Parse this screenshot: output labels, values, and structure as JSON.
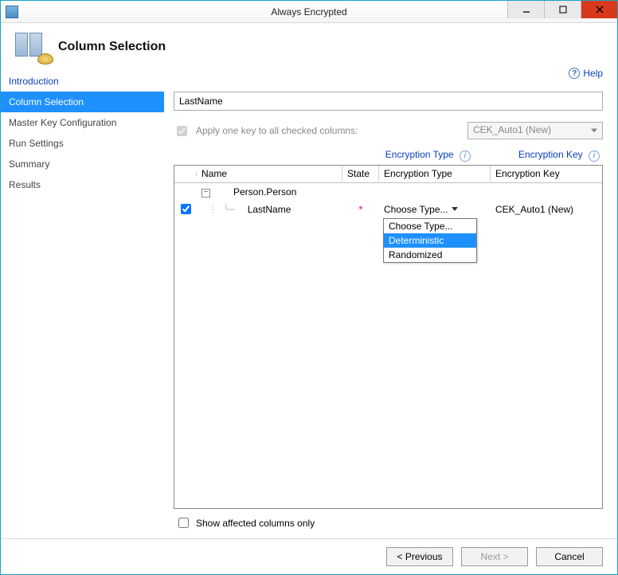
{
  "window": {
    "title": "Always Encrypted"
  },
  "header": {
    "title": "Column Selection"
  },
  "nav": {
    "items": [
      {
        "label": "Introduction"
      },
      {
        "label": "Column Selection"
      },
      {
        "label": "Master Key Configuration"
      },
      {
        "label": "Run Settings"
      },
      {
        "label": "Summary"
      },
      {
        "label": "Results"
      }
    ]
  },
  "help": {
    "label": "Help"
  },
  "search": {
    "value": "LastName"
  },
  "apply": {
    "label": "Apply one key to all checked columns:",
    "key": "CEK_Auto1 (New)"
  },
  "links": {
    "enc_type": "Encryption Type",
    "enc_key": "Encryption Key"
  },
  "grid": {
    "headers": {
      "name": "Name",
      "state": "State",
      "type": "Encryption Type",
      "key": "Encryption Key"
    },
    "parent": "Person.Person",
    "row": {
      "name": "LastName",
      "state": "*",
      "type_label": "Choose Type...",
      "key_label": "CEK_Auto1 (New)"
    },
    "dropdown": {
      "opt0": "Choose Type...",
      "opt1": "Deterministic",
      "opt2": "Randomized"
    }
  },
  "show_affected": {
    "label": "Show affected columns only"
  },
  "buttons": {
    "previous": "< Previous",
    "next": "Next >",
    "cancel": "Cancel"
  }
}
